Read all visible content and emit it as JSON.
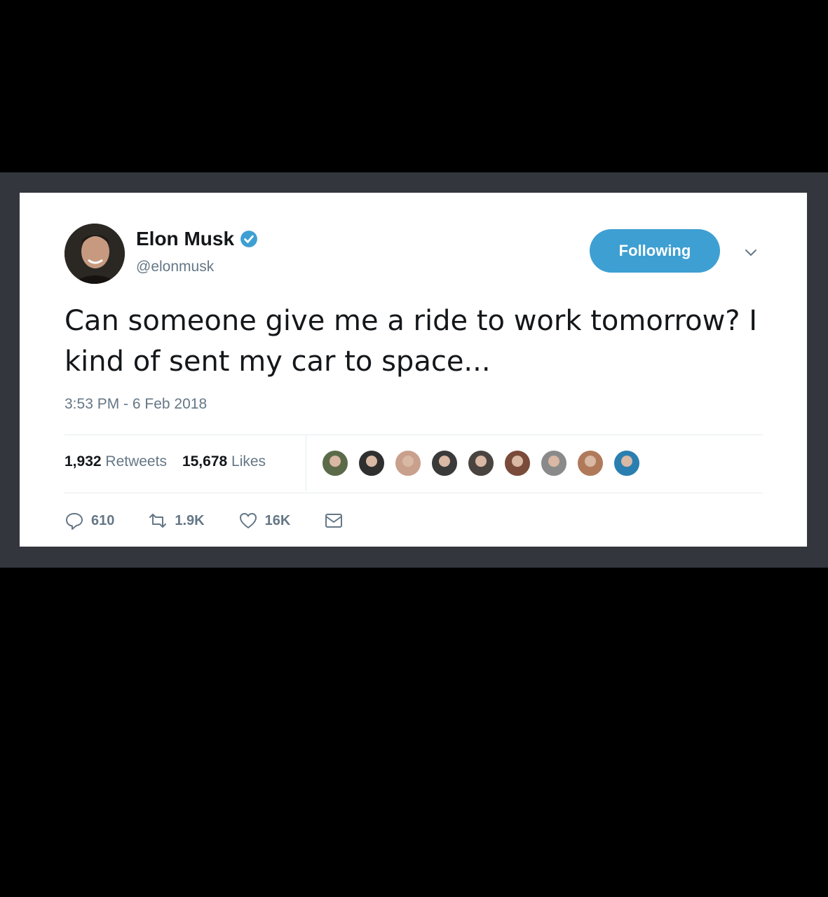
{
  "tweet": {
    "author_name": "Elon Musk",
    "handle": "@elonmusk",
    "follow_button_label": "Following",
    "text": "Can someone give me a ride to work tomorrow? I kind of sent my car to space...",
    "timestamp": "3:53 PM - 6 Feb 2018",
    "retweets_count": "1,932",
    "retweets_label": "Retweets",
    "likes_count": "15,678",
    "likes_label": "Likes",
    "reply_count": "610",
    "retweet_action_count": "1.9K",
    "like_action_count": "16K"
  },
  "liker_avatars": [
    {
      "name": "liker-avatar-1",
      "color": "#5b6b4a"
    },
    {
      "name": "liker-avatar-2",
      "color": "#2f2f2f"
    },
    {
      "name": "liker-avatar-3",
      "color": "#c8a08c"
    },
    {
      "name": "liker-avatar-4",
      "color": "#3a3a3a"
    },
    {
      "name": "liker-avatar-5",
      "color": "#4a4440"
    },
    {
      "name": "liker-avatar-6",
      "color": "#7a4a3a"
    },
    {
      "name": "liker-avatar-7",
      "color": "#8a8a8a"
    },
    {
      "name": "liker-avatar-8",
      "color": "#b07a5a"
    },
    {
      "name": "liker-avatar-9",
      "color": "#2a7fb0"
    }
  ],
  "colors": {
    "accent": "#3e9fd2",
    "text_primary": "#14171a",
    "text_secondary": "#657786"
  },
  "icons": {
    "verified": "verified-badge-icon",
    "chevron": "chevron-down-icon",
    "reply": "reply-icon",
    "retweet": "retweet-icon",
    "like": "heart-icon",
    "dm": "envelope-icon"
  }
}
